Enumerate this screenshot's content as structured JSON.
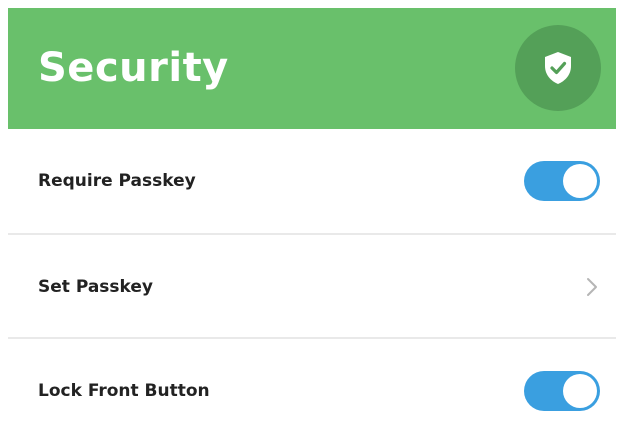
{
  "header": {
    "title": "Security",
    "badge_icon": "shield-check-icon",
    "background_color": "#69c06b",
    "badge_color": "#54a058"
  },
  "settings": [
    {
      "label": "Require Passkey",
      "control": "toggle",
      "enabled": true
    },
    {
      "label": "Set Passkey",
      "control": "chevron",
      "icon": "chevron-right-icon"
    },
    {
      "label": "Lock Front Button",
      "control": "toggle",
      "enabled": true
    }
  ],
  "colors": {
    "toggle_on": "#3a9fe0",
    "divider": "#e9e9e9",
    "label_text": "#222222",
    "chevron": "#b5b5b5"
  }
}
